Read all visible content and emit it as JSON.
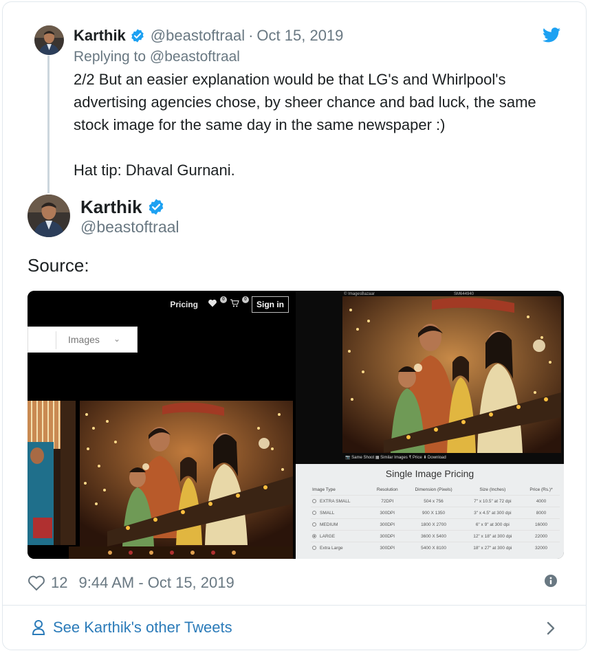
{
  "reply_tweet": {
    "name": "Karthik",
    "handle": "@beastoftraal",
    "separator": "·",
    "date": "Oct 15, 2019",
    "replying_prefix": "Replying to",
    "replying_to": "@beastoftraal",
    "text_lines": [
      "2/2 But an easier explanation would be that LG's and Whirlpool's advertising agencies chose, by sheer chance and bad luck, the same stock image for the same day in the same newspaper :)",
      "Hat tip: Dhaval Gurnani."
    ]
  },
  "tweet": {
    "name": "Karthik",
    "handle": "@beastoftraal",
    "text": "Source:",
    "likes": "12",
    "timestamp": "9:44 AM - Oct 15, 2019"
  },
  "media_left": {
    "nav_pricing": "Pricing",
    "wishlist_badge": "0",
    "cart_badge": "0",
    "sign_in": "Sign in",
    "images_dropdown": "Images",
    "chevron": "⌄"
  },
  "media_right": {
    "credit": "© ImagesBazaar",
    "code": "SM644940",
    "actions": "📷 Same Shoot ▦ Similar Images ₹ Price ⬇ Download",
    "pricing_title": "Single Image Pricing",
    "columns": [
      "Image Type",
      "Resolution",
      "Dimension (Pixels)",
      "Size (Inches)",
      "Price (Rs.)*"
    ],
    "rows": [
      {
        "type": "EXTRA SMALL",
        "resolution": "72DPI",
        "dimension": "504 x 756",
        "size": "7\" x 10.5\" at 72 dpi",
        "price": "4000",
        "selected": false
      },
      {
        "type": "SMALL",
        "resolution": "300DPI",
        "dimension": "900 X 1350",
        "size": "3\" x 4.5\" at 300 dpi",
        "price": "8000",
        "selected": false
      },
      {
        "type": "MEDIUM",
        "resolution": "300DPI",
        "dimension": "1800 X 2700",
        "size": "6\" x 9\" at 300 dpi",
        "price": "16000",
        "selected": false
      },
      {
        "type": "LARGE",
        "resolution": "300DPI",
        "dimension": "3600 X 5400",
        "size": "12\" x 18\" at 300 dpi",
        "price": "22000",
        "selected": true
      },
      {
        "type": "Extra Large",
        "resolution": "300DPI",
        "dimension": "5400 X 8100",
        "size": "18\" x 27\" at 300 dpi",
        "price": "32000",
        "selected": false
      }
    ]
  },
  "footer": {
    "see_more": "See Karthik's other Tweets"
  },
  "colors": {
    "twitter_blue": "#1da1f2",
    "link_blue": "#2b7bb9",
    "muted_gray": "#697882",
    "verified_blue": "#1da1f2"
  },
  "icons": [
    "twitter-bird-icon",
    "verified-badge-icon",
    "heart-icon",
    "info-icon",
    "person-icon",
    "chevron-right-icon"
  ]
}
